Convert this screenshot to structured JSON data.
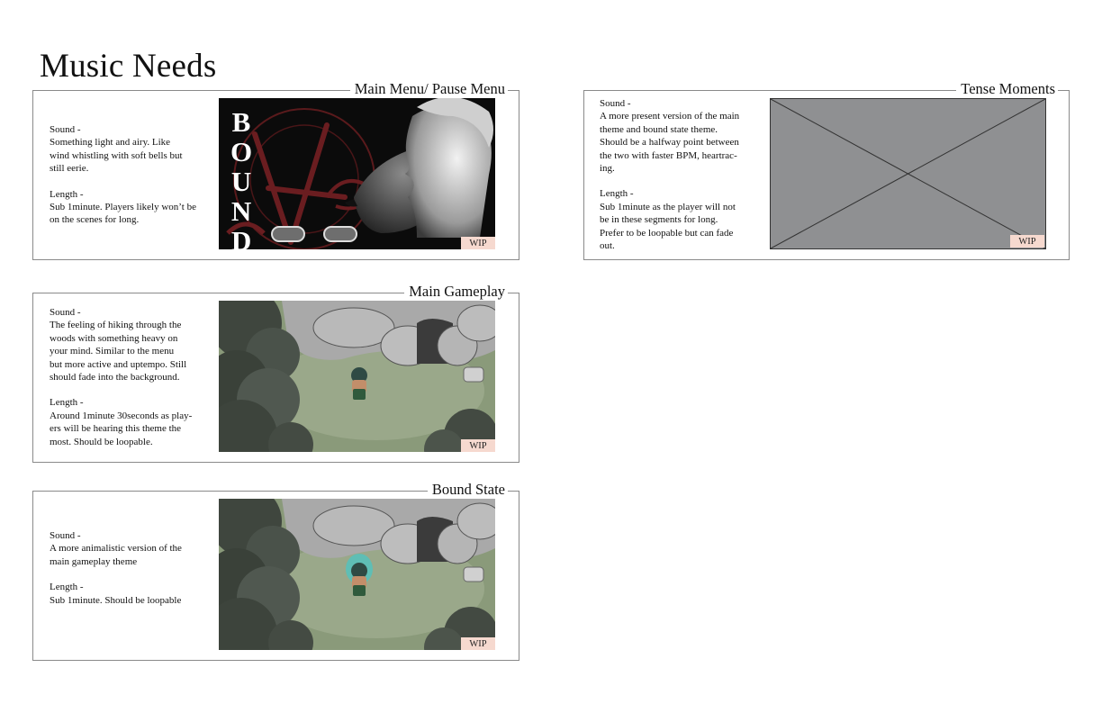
{
  "page": {
    "title": "Music Needs"
  },
  "wip_label": "WIP",
  "panels": {
    "main_menu": {
      "title": "Main Menu/ Pause Menu",
      "sound_label": "Sound -",
      "sound_text": [
        "Something light and airy. Like",
        "wind whistling with soft bells but",
        "still eerie."
      ],
      "length_label": "Length -",
      "length_text": [
        "Sub 1minute. Players likely won’t be",
        "on the scenes for long."
      ],
      "logo_letters": [
        "B",
        "O",
        "U",
        "N",
        "D"
      ]
    },
    "main_gameplay": {
      "title": "Main Gameplay",
      "sound_label": "Sound -",
      "sound_text": [
        "The feeling of hiking through the",
        "woods with something heavy on",
        "your mind. Similar to the menu",
        "but more active and uptempo. Still",
        "should fade into the background."
      ],
      "length_label": "Length -",
      "length_text": [
        "Around 1minute 30seconds as play-",
        "ers will be hearing this theme the",
        "most. Should be loopable."
      ]
    },
    "bound_state": {
      "title": "Bound State",
      "sound_label": "Sound -",
      "sound_text": [
        "A more animalistic version of the",
        "main gameplay theme"
      ],
      "length_label": "Length -",
      "length_text": [
        "Sub 1minute. Should be loopable"
      ]
    },
    "tense_moments": {
      "title": "Tense Moments",
      "sound_label": "Sound -",
      "sound_text": [
        "A more present version of the main",
        "theme and bound state theme.",
        "Should be a halfway point between",
        "the two with faster BPM, heartrac-",
        "ing."
      ],
      "length_label": "Length -",
      "length_text": [
        "Sub 1minute as the player will not",
        "be in these segments for long.",
        "Prefer to be loopable but can fade",
        "out."
      ]
    }
  },
  "colors": {
    "panel_border": "#8a8a8a",
    "wip_badge": "#f6d9cf",
    "placeholder_fill": "#8f9092",
    "menu_accent": "#7a1e22",
    "forest_ground": "#8a9a7a",
    "rock": "#a9a9a9",
    "aura": "#2fd0d8"
  }
}
